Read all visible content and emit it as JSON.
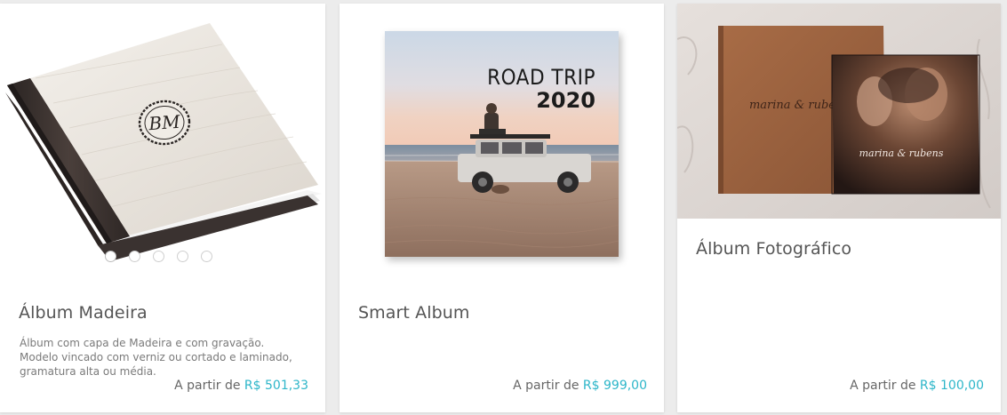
{
  "theme": {
    "accent": "#2db6c9"
  },
  "products": [
    {
      "title": "Álbum Madeira",
      "description": "Álbum com capa de Madeira e com gravação. Modelo vincado com verniz ou cortado e laminado, gramatura alta ou média.",
      "price_prefix": "A partir de",
      "price": "R$ 501,33",
      "monogram": "BM",
      "carousel_dots": 5,
      "carousel_active": 0
    },
    {
      "title": "Smart Album",
      "description": "",
      "price_prefix": "A partir de",
      "price": "R$ 999,00",
      "cover_line1": "ROAD TRIP",
      "cover_line2": "2020"
    },
    {
      "title": "Álbum Fotográfico",
      "description": "",
      "price_prefix": "A partir de",
      "price": "R$ 100,00",
      "cover_text_back": "marina & rubens",
      "cover_text_front": "marina & rubens"
    }
  ]
}
